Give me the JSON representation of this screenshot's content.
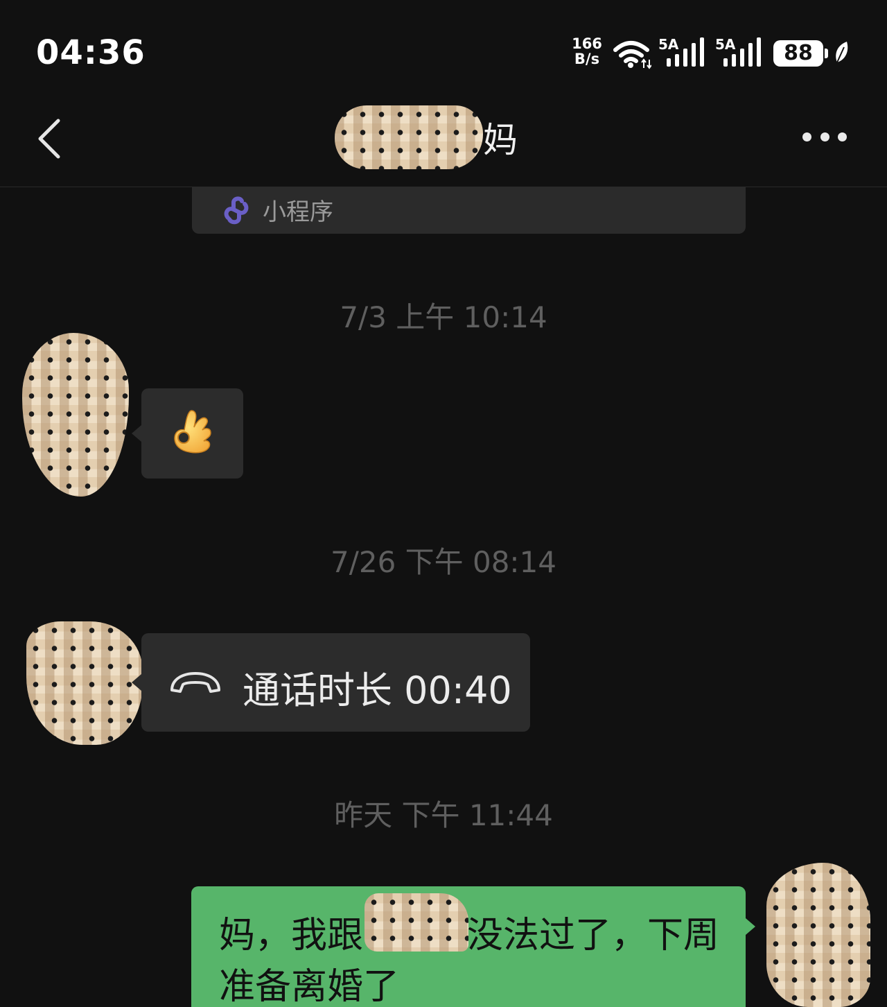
{
  "status_bar": {
    "time": "04:36",
    "net_speed_value": "166",
    "net_speed_unit": "B/s",
    "signal1_label": "5A",
    "signal2_label": "5A",
    "battery_level": "88"
  },
  "header": {
    "title_visible": "妈",
    "back_icon": "chevron-left-icon",
    "more_icon": "more-icon"
  },
  "mini_program": {
    "icon": "mini-program-icon",
    "label": "小程序"
  },
  "messages": [
    {
      "type": "time",
      "text": "7/3 上午 10:14"
    },
    {
      "type": "emoji",
      "side": "left",
      "emoji": "👌"
    },
    {
      "type": "time",
      "text": "7/26 下午 08:14"
    },
    {
      "type": "call",
      "side": "left",
      "icon": "phone-hangup-icon",
      "text": "通话时长 00:40"
    },
    {
      "type": "time",
      "text": "昨天 下午 11:44"
    },
    {
      "type": "text",
      "side": "right",
      "line1": "妈，我跟",
      "line1_rest": "没法过了，下周",
      "line2": "准备离婚了"
    }
  ],
  "colors": {
    "background": "#111111",
    "incoming_bubble": "#2c2c2c",
    "outgoing_bubble": "#57b56a",
    "timestamp": "#5f5f5f",
    "mini_program_accent": "#6a5fc6"
  }
}
